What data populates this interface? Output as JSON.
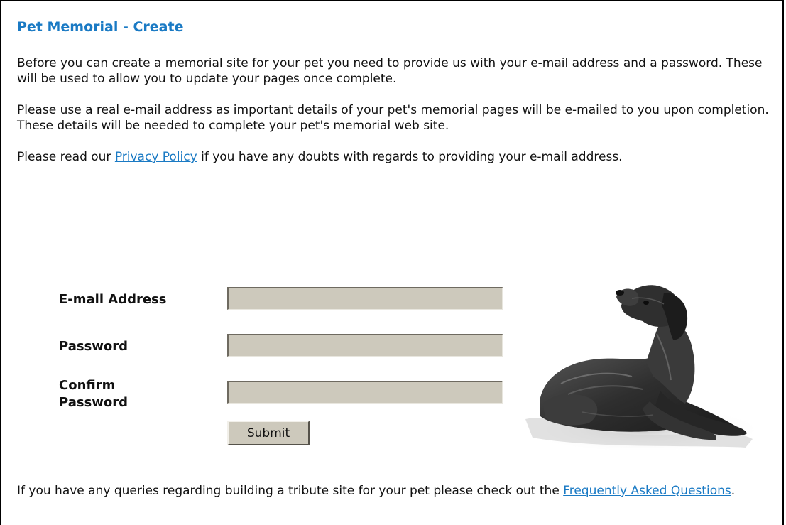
{
  "page": {
    "title": "Pet Memorial - Create",
    "intro_paragraph": "Before you can create a memorial site for your pet you need to provide us with your e-mail address and a password. These will be used to allow you to update your pages once complete.",
    "email_paragraph": "Please use a real e-mail address as important details of your pet's memorial pages will be e-mailed to you upon completion. These details will be needed to complete your pet's memorial web site.",
    "privacy_prefix": "Please read our ",
    "privacy_link": "Privacy Policy",
    "privacy_suffix": " if you have any doubts with regards to providing your e-mail address."
  },
  "form": {
    "email_label": "E-mail Address",
    "email_value": "",
    "password_label": "Password",
    "password_value": "",
    "confirm_label_line1": "Confirm",
    "confirm_label_line2": "Password",
    "confirm_value": "",
    "submit_label": "Submit"
  },
  "footer": {
    "prefix": "If you have any queries regarding building a tribute site for your pet please check out the ",
    "faq_link": "Frequently Asked Questions",
    "suffix": "."
  },
  "colors": {
    "heading": "#1a7ac4",
    "link": "#1a7ac4",
    "field_background": "#cdc9bc"
  },
  "image": {
    "subject": "dog-illustration"
  }
}
